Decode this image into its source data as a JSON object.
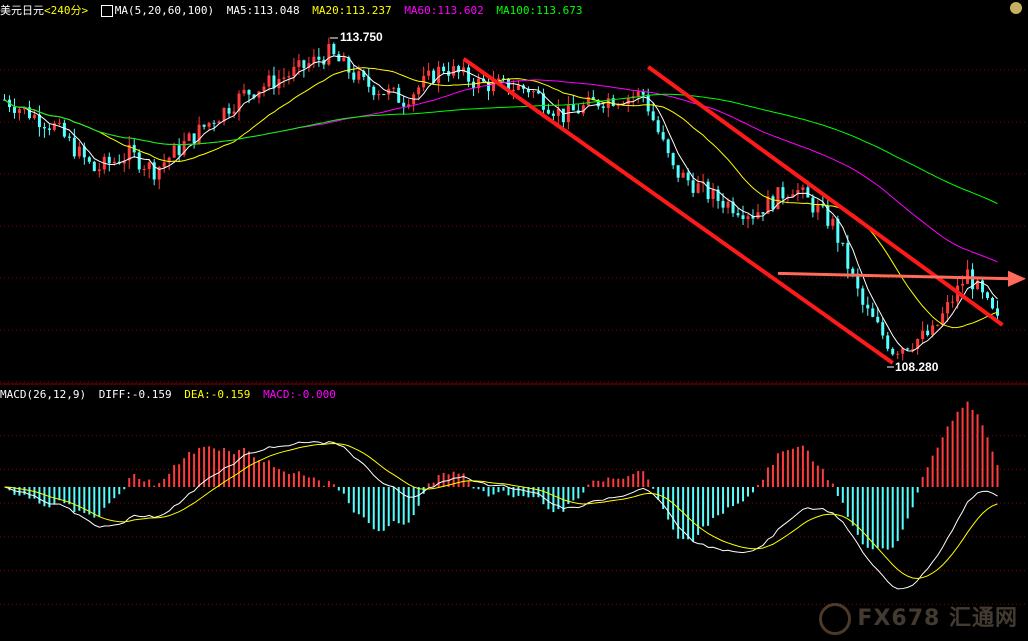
{
  "header": {
    "symbol": "美元日元",
    "period": "<240分>",
    "ma_spec": "MA(5,20,60,100)",
    "ma5": "MA5:113.048",
    "ma20": "MA20:113.237",
    "ma60": "MA60:113.602",
    "ma100": "MA100:113.673"
  },
  "macd_header": {
    "spec": "MACD(26,12,9)",
    "diff": "DIFF:-0.159",
    "dea": "DEA:-0.159",
    "macd": "MACD:-0.000"
  },
  "annotations": {
    "high": "113.750",
    "low": "108.280"
  },
  "watermark": "FX678 汇通网",
  "colors": {
    "up": "#ff3b3b",
    "down": "#54ffff",
    "ma5": "#ffffff",
    "ma20": "#ffff00",
    "ma60": "#ff00ff",
    "ma100": "#00ff00",
    "trend": "#ff1a1a",
    "arrow": "#ff6a5a",
    "grid": "#8b0000"
  },
  "chart_data": [
    {
      "type": "candlestick",
      "title": "美元日元 <240分>",
      "y_range": [
        107.7,
        114.4
      ],
      "x_bars": 200,
      "grid": true,
      "moving_averages": [
        "MA5",
        "MA20",
        "MA60",
        "MA100"
      ],
      "price_path": [
        [
          0,
          112.9
        ],
        [
          10,
          112.4
        ],
        [
          18,
          111.6
        ],
        [
          25,
          111.9
        ],
        [
          30,
          111.6
        ],
        [
          40,
          112.4
        ],
        [
          48,
          113.0
        ],
        [
          58,
          113.4
        ],
        [
          65,
          113.75
        ],
        [
          72,
          113.2
        ],
        [
          80,
          112.9
        ],
        [
          88,
          113.5
        ],
        [
          95,
          113.2
        ],
        [
          105,
          113.1
        ],
        [
          112,
          112.6
        ],
        [
          120,
          112.9
        ],
        [
          128,
          113.0
        ],
        [
          134,
          111.6
        ],
        [
          142,
          111.1
        ],
        [
          150,
          110.8
        ],
        [
          158,
          111.3
        ],
        [
          166,
          110.6
        ],
        [
          172,
          109.1
        ],
        [
          178,
          108.3
        ],
        [
          186,
          108.6
        ],
        [
          193,
          109.7
        ],
        [
          199,
          108.8
        ]
      ],
      "labeled_high": 113.75,
      "labeled_low": 108.28
    },
    {
      "type": "bar",
      "title": "MACD(26,12,9)",
      "series": [
        {
          "name": "DIFF",
          "value": -0.159
        },
        {
          "name": "DEA",
          "value": -0.159
        },
        {
          "name": "MACD",
          "value": -0.0
        }
      ],
      "y_range": [
        -0.55,
        0.55
      ]
    }
  ]
}
